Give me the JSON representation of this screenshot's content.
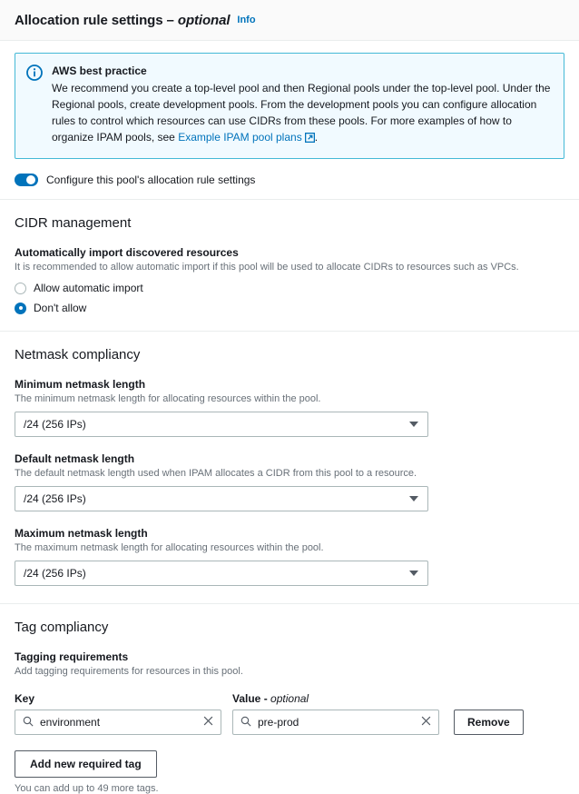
{
  "header": {
    "title": "Allocation rule settings",
    "dash": "–",
    "optional": "optional",
    "info_label": "Info"
  },
  "alert": {
    "icon": "info-circle-icon",
    "title": "AWS best practice",
    "text_before": "We recommend you create a top-level pool and then Regional pools under the top-level pool. Under the Regional pools, create development pools. From the development pools you can configure allocation rules to control which resources can use CIDRs from these pools. For more examples of how to organize IPAM pools, see ",
    "link_text": "Example IPAM pool plans",
    "link_icon": "external-link-icon",
    "text_after": "."
  },
  "configure_toggle": {
    "label": "Configure this pool's allocation rule settings",
    "enabled": true
  },
  "cidr_management": {
    "section_title": "CIDR management",
    "field_label": "Automatically import discovered resources",
    "field_desc": "It is recommended to allow automatic import if this pool will be used to allocate CIDRs to resources such as VPCs.",
    "options": [
      {
        "label": "Allow automatic import",
        "selected": false
      },
      {
        "label": "Don't allow",
        "selected": true
      }
    ]
  },
  "netmask_compliancy": {
    "section_title": "Netmask compliancy",
    "fields": [
      {
        "label": "Minimum netmask length",
        "desc": "The minimum netmask length for allocating resources within the pool.",
        "value": "/24 (256 IPs)"
      },
      {
        "label": "Default netmask length",
        "desc": "The default netmask length used when IPAM allocates a CIDR from this pool to a resource.",
        "value": "/24 (256 IPs)"
      },
      {
        "label": "Maximum netmask length",
        "desc": "The maximum netmask length for allocating resources within the pool.",
        "value": "/24 (256 IPs)"
      }
    ]
  },
  "tag_compliancy": {
    "section_title": "Tag compliancy",
    "field_label": "Tagging requirements",
    "field_desc": "Add tagging requirements for resources in this pool.",
    "key_header": "Key",
    "value_header": "Value",
    "value_header_optional": "optional",
    "rows": [
      {
        "key_value": "environment",
        "value_value": "pre-prod",
        "remove_label": "Remove",
        "search_icon": "search-icon",
        "clear_icon": "clear-x-icon"
      }
    ],
    "add_button_label": "Add new required tag",
    "hint": "You can add up to 49 more tags."
  },
  "colors": {
    "accent": "#0073bb",
    "alert_bg": "#f1faff",
    "alert_border": "#44b9d6",
    "text": "#16191f",
    "muted": "#687078",
    "border": "#aab7b8",
    "divider": "#eaeded"
  }
}
